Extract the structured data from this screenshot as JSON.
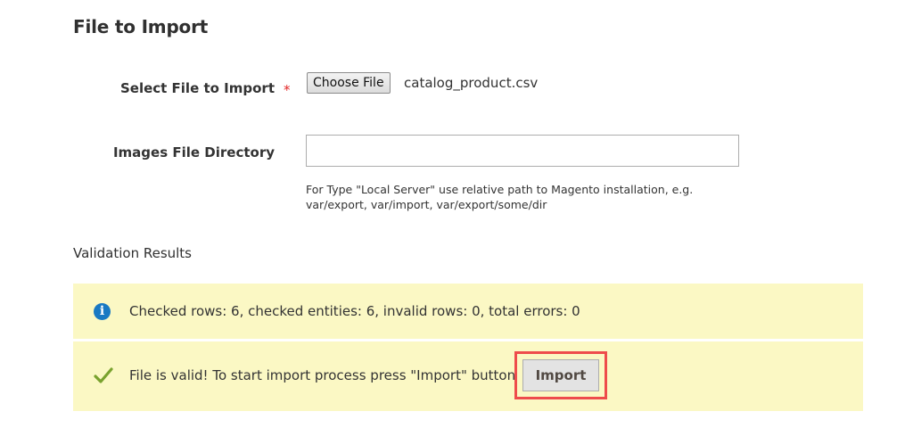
{
  "section": {
    "title": "File to Import"
  },
  "select_file": {
    "label": "Select File to Import",
    "required_mark": "*",
    "button_label": "Choose File",
    "file_name": "catalog_product.csv"
  },
  "images_dir": {
    "label": "Images File Directory",
    "value": "",
    "note_line1": "For Type \"Local Server\" use relative path to Magento installation, e.g.",
    "note_line2": "var/export, var/import, var/export/some/dir"
  },
  "validation": {
    "title": "Validation Results",
    "info_icon": "info-icon",
    "info_text": "Checked rows: 6, checked entities: 6, invalid rows: 0, total errors: 0",
    "success_icon": "checkmark-icon",
    "success_text": "File is valid! To start import process press \"Import\" button",
    "import_button": "Import"
  },
  "colors": {
    "message_background": "#fbf8c4",
    "info_icon": "#1979c3",
    "check_icon": "#79a22e",
    "highlight_border": "#ee4c4c",
    "required_star": "#e22626"
  }
}
